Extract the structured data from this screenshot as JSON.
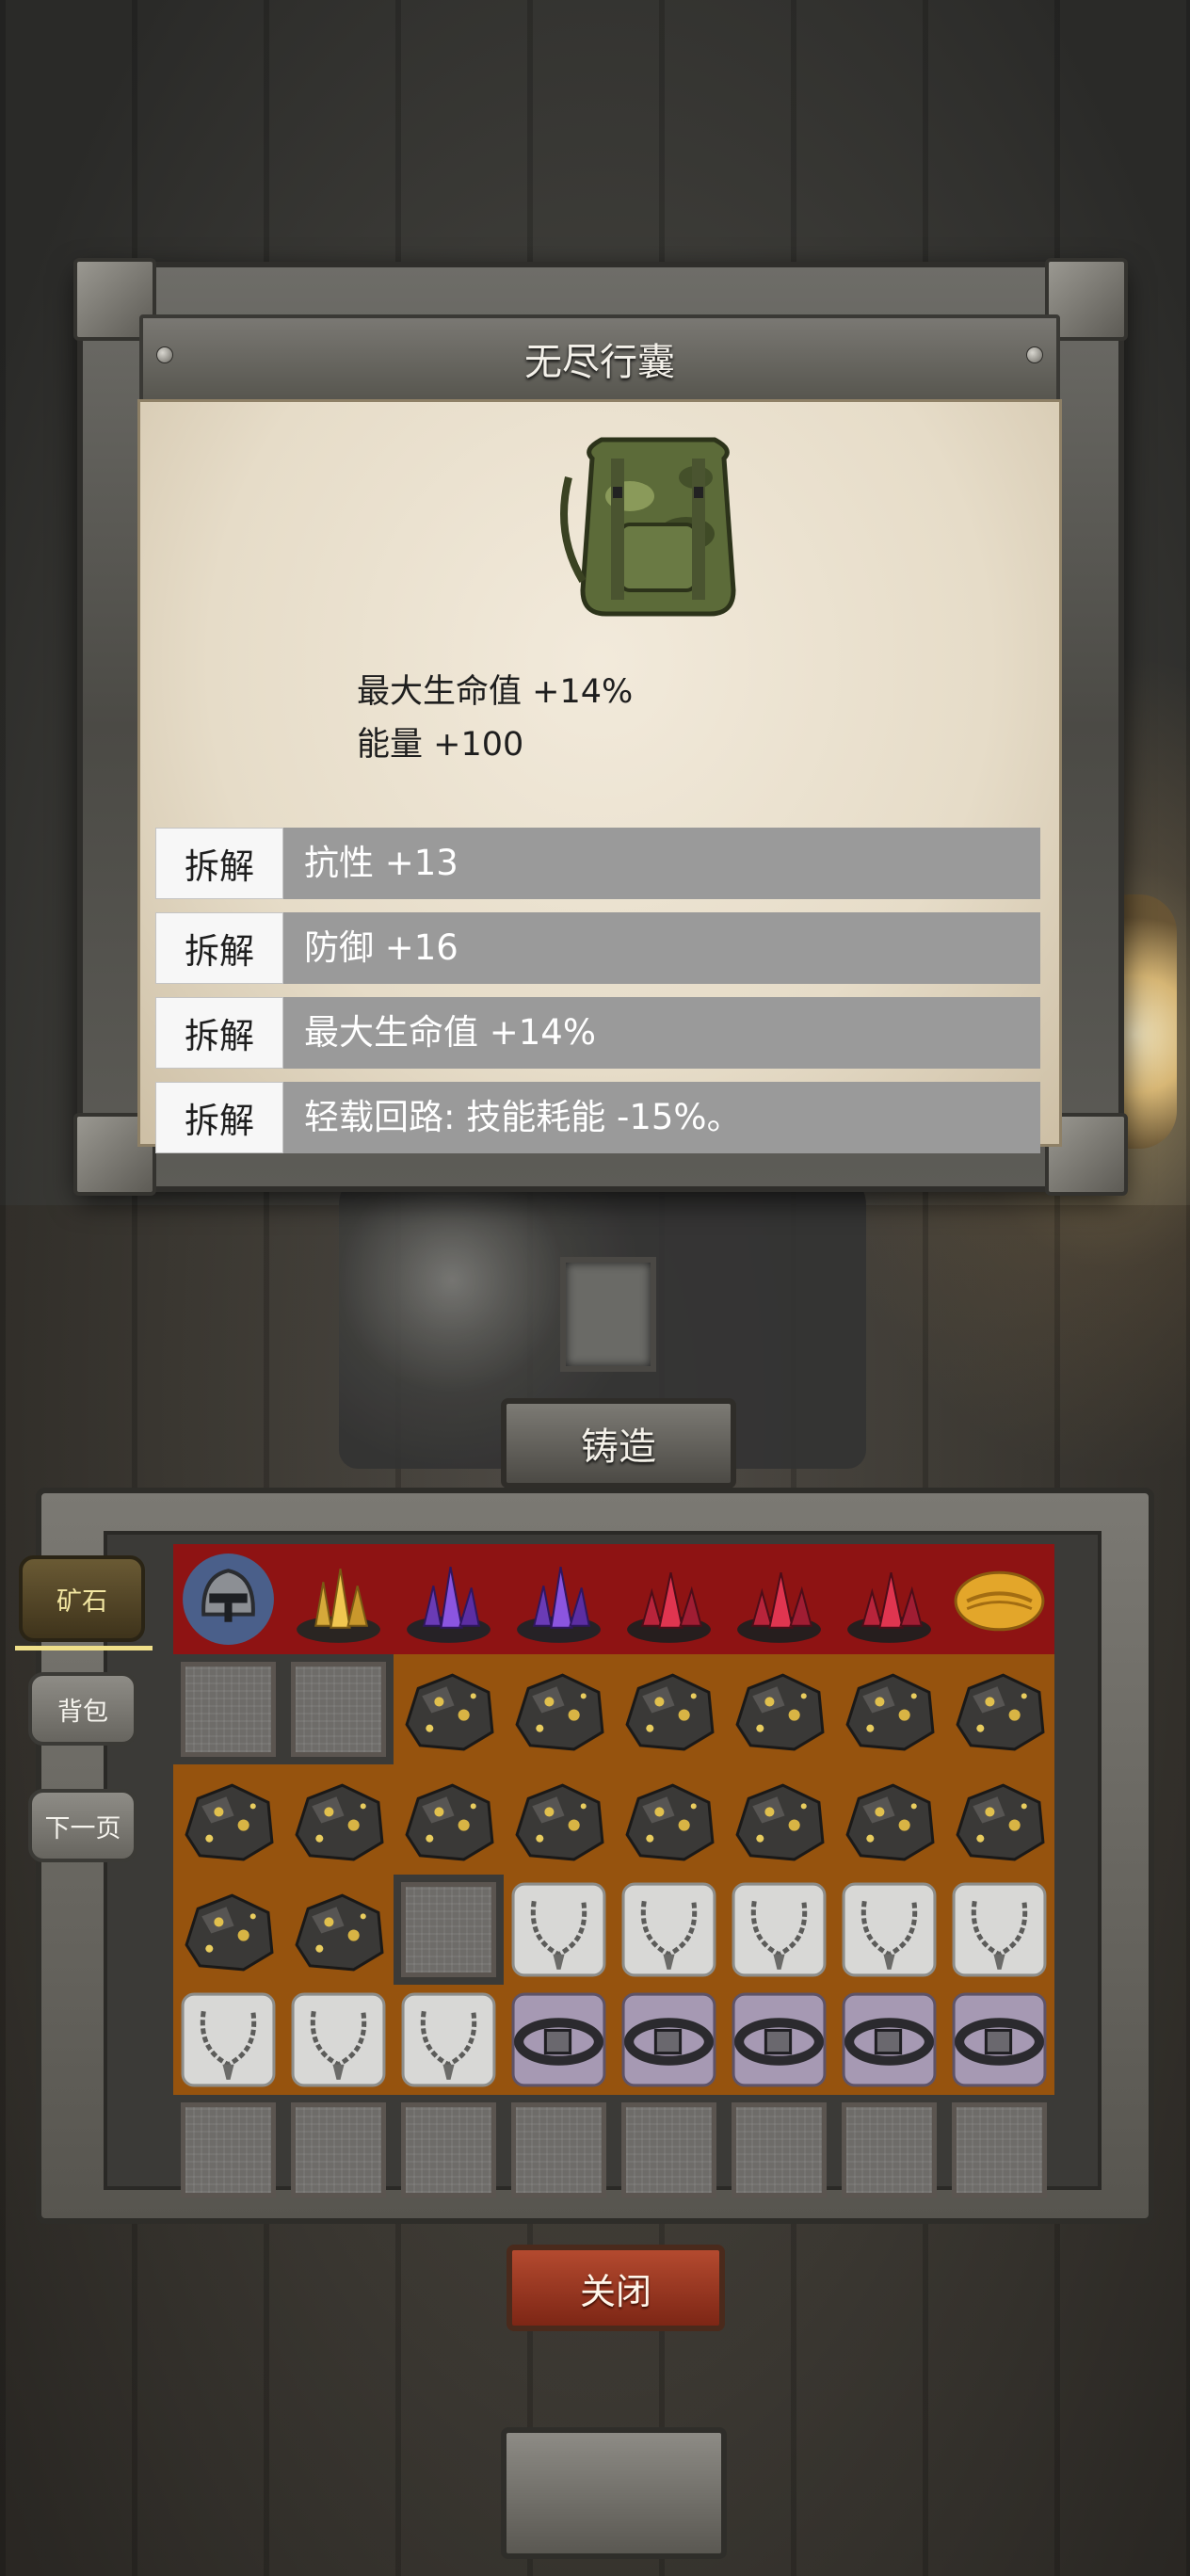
{
  "popup": {
    "title": "无尽行囊",
    "item_icon": "camo-backpack-icon",
    "stats": [
      "最大生命值 +14%",
      "能量 +100"
    ],
    "affixes": [
      {
        "button": "拆解",
        "text": "抗性 +13"
      },
      {
        "button": "拆解",
        "text": "防御 +16"
      },
      {
        "button": "拆解",
        "text": "最大生命值 +14%"
      },
      {
        "button": "拆解",
        "text": "轻载回路: 技能耗能 -15%。"
      }
    ]
  },
  "forge_label": "铸造",
  "tabs": {
    "ore": "矿石",
    "backpack": "背包",
    "next_page": "下一页"
  },
  "close_label": "关闭",
  "inventory": {
    "rows": [
      [
        "iron-helmet-icon",
        "gold-crystal-icon",
        "purple-crystal-icon",
        "purple-crystal-icon",
        "red-crystal-icon",
        "red-crystal-icon",
        "red-crystal-icon",
        "amber-larva-icon"
      ],
      [
        "empty",
        "empty",
        "gold-ore-icon",
        "gold-ore-icon",
        "gold-ore-icon",
        "gold-ore-icon",
        "gold-ore-icon",
        "gold-ore-icon"
      ],
      [
        "gold-ore-icon",
        "gold-ore-icon",
        "gold-ore-icon",
        "gold-ore-icon",
        "gold-ore-icon",
        "gold-ore-icon",
        "gold-ore-icon",
        "gold-ore-icon"
      ],
      [
        "gold-ore-icon",
        "gold-ore-icon",
        "empty",
        "silver-necklace-icon",
        "silver-necklace-icon",
        "silver-necklace-icon",
        "silver-necklace-icon",
        "silver-necklace-icon"
      ],
      [
        "silver-necklace-icon",
        "silver-necklace-icon",
        "silver-necklace-icon",
        "leather-belt-icon",
        "leather-belt-icon",
        "leather-belt-icon",
        "leather-belt-icon",
        "leather-belt-icon"
      ],
      [
        "empty",
        "empty",
        "empty",
        "empty",
        "empty",
        "empty",
        "empty",
        "empty"
      ]
    ],
    "row_backgrounds": [
      "red",
      "orange",
      "orange",
      "orange",
      "orange",
      "none"
    ]
  },
  "colors": {
    "affix_bar": "#9a9a9a",
    "row_red": "#8e1313",
    "row_orange": "#96530e",
    "close_button": "#a23d23",
    "ore_tab_text": "#f3e7a2"
  }
}
